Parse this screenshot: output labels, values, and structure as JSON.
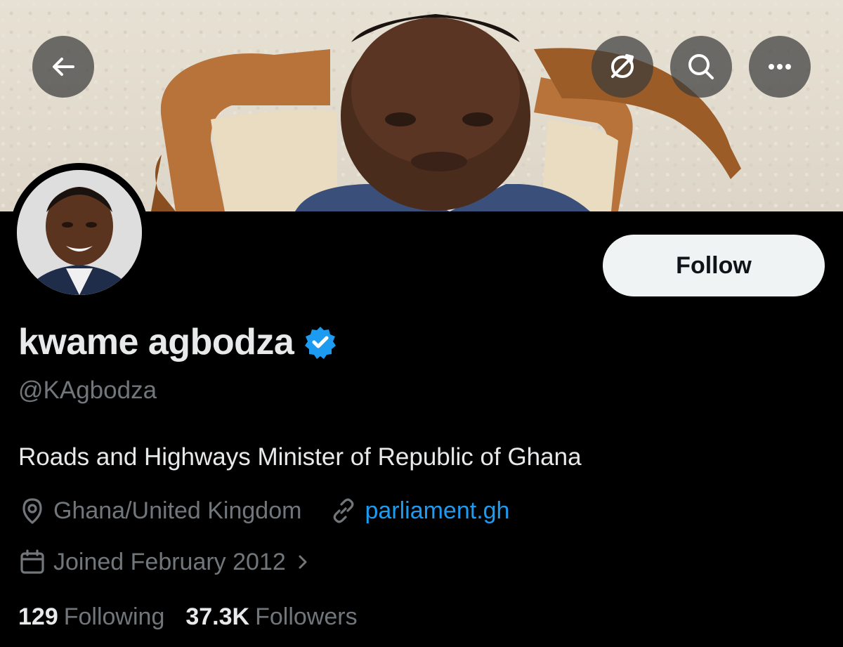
{
  "header": {
    "back_icon": "arrow-left-icon",
    "translate_icon": "translate-icon",
    "search_icon": "search-icon",
    "more_icon": "more-horizontal-icon"
  },
  "profile": {
    "display_name": "kwame agbodza",
    "verified": true,
    "verified_color": "#1d9bf0",
    "handle": "@KAgbodza",
    "bio": "Roads and Highways Minister of Republic of Ghana",
    "location": "Ghana/United Kingdom",
    "website": "parliament.gh",
    "joined": "Joined February 2012",
    "follow_label": "Follow"
  },
  "stats": {
    "following_count": "129",
    "following_label": "Following",
    "followers_count": "37.3K",
    "followers_label": "Followers"
  },
  "colors": {
    "background": "#000000",
    "text_primary": "#e7e9ea",
    "text_secondary": "#71767b",
    "link": "#1d9bf0",
    "follow_button_bg": "#eff3f4"
  }
}
